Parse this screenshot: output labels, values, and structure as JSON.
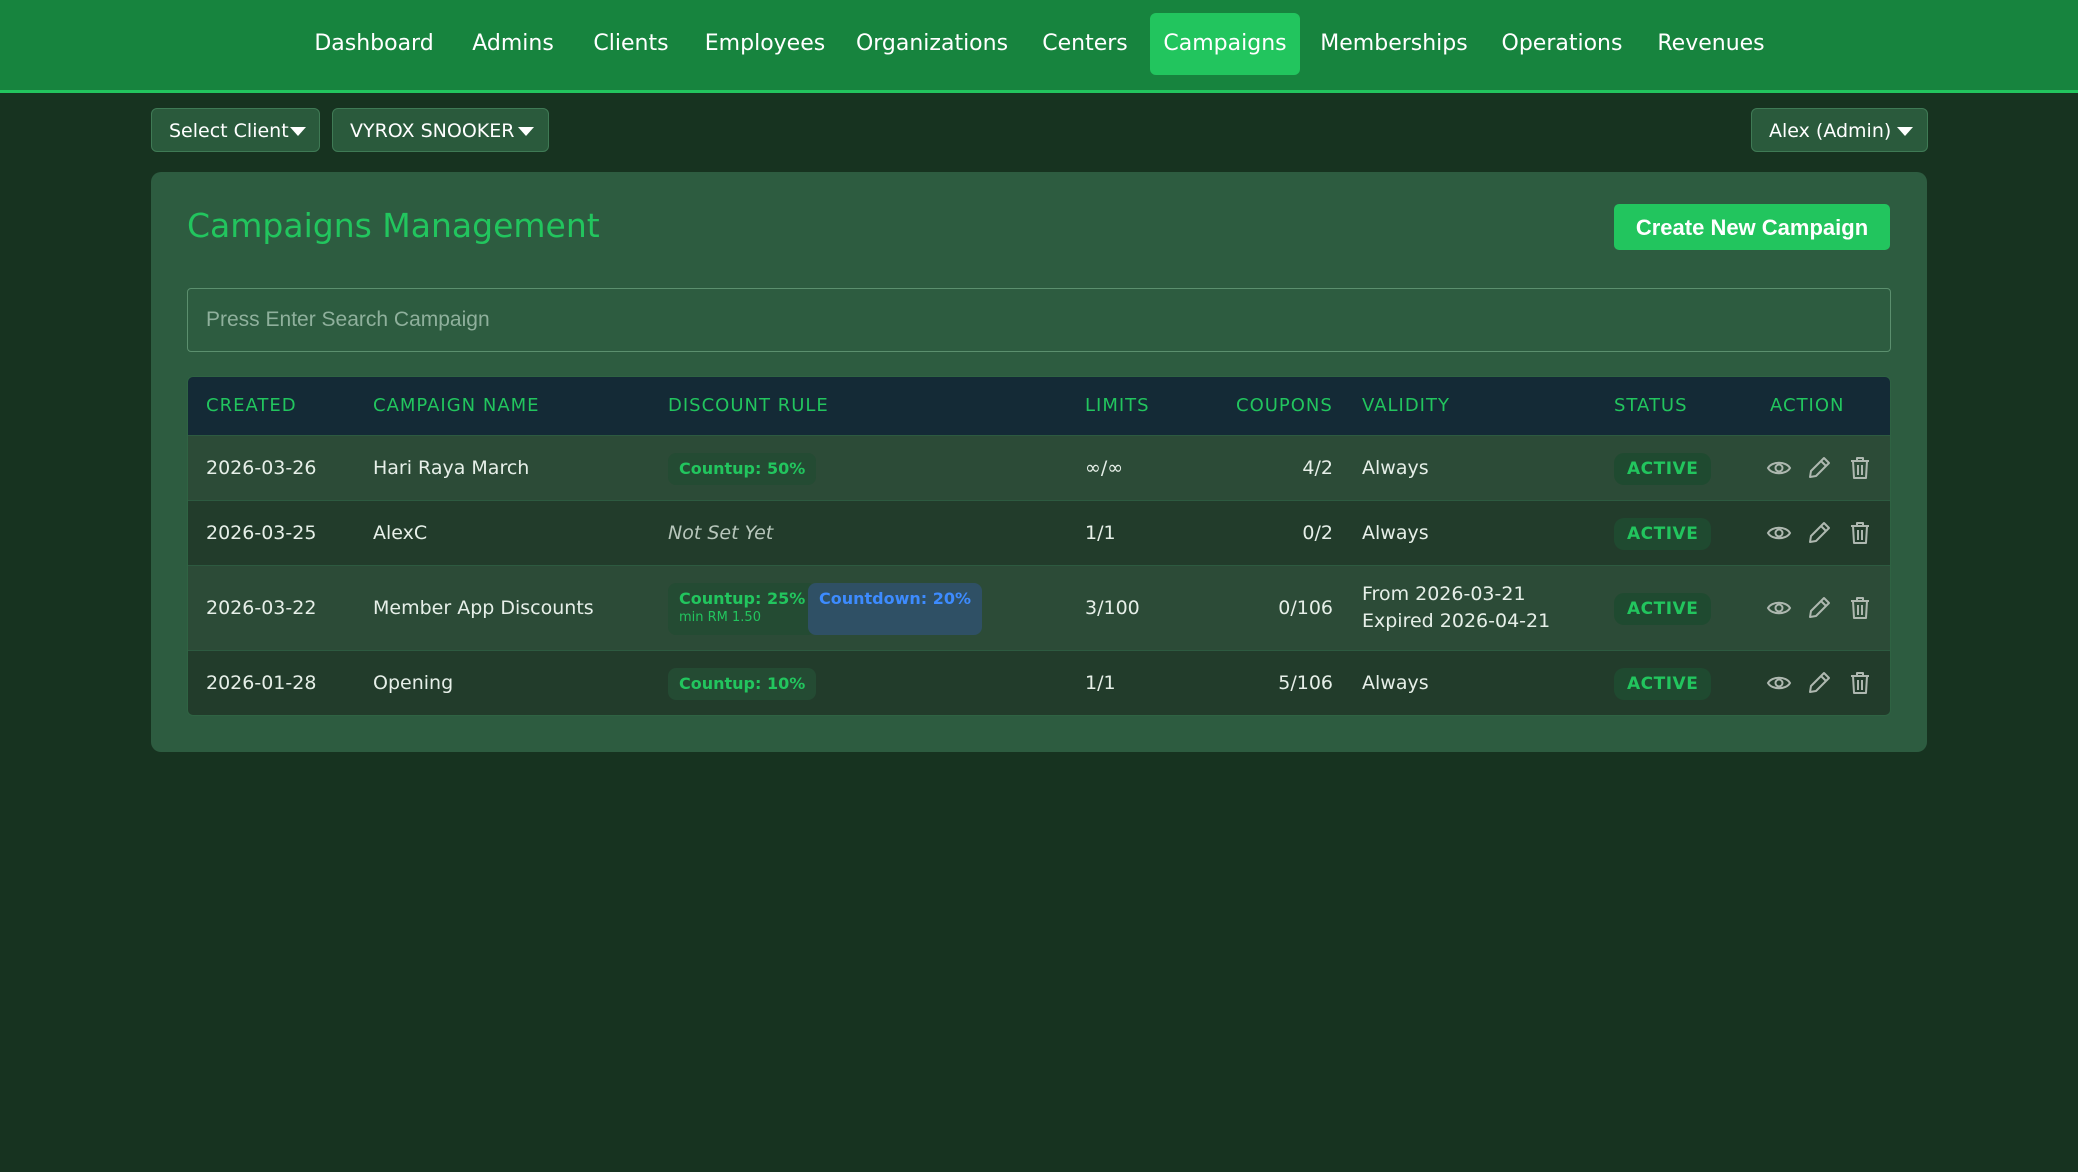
{
  "nav": {
    "items": [
      {
        "label": "Dashboard",
        "active": false
      },
      {
        "label": "Admins",
        "active": false
      },
      {
        "label": "Clients",
        "active": false
      },
      {
        "label": "Employees",
        "active": false
      },
      {
        "label": "Organizations",
        "active": false
      },
      {
        "label": "Centers",
        "active": false
      },
      {
        "label": "Campaigns",
        "active": true
      },
      {
        "label": "Memberships",
        "active": false
      },
      {
        "label": "Operations",
        "active": false
      },
      {
        "label": "Revenues",
        "active": false
      }
    ]
  },
  "selectors": {
    "client": "Select Client",
    "center": "VYROX SNOOKER",
    "user": "Alex (Admin)"
  },
  "page": {
    "title": "Campaigns Management",
    "create_button": "Create New Campaign",
    "search_placeholder": "Press Enter Search Campaign"
  },
  "table": {
    "headers": {
      "created": "CREATED",
      "name": "CAMPAIGN NAME",
      "rule": "DISCOUNT RULE",
      "limits": "LIMITS",
      "coupons": "COUPONS",
      "validity": "VALIDITY",
      "status": "STATUS",
      "action": "ACTION"
    },
    "rows": [
      {
        "created": "2026-03-26",
        "name": "Hari Raya March",
        "rule_none": "",
        "rule_a": "Countup: 50%",
        "rule_a_sub": "",
        "rule_b": "",
        "limits": "∞/∞",
        "coupons": "4/2",
        "validity_1": "Always",
        "validity_2": "",
        "status": "ACTIVE"
      },
      {
        "created": "2026-03-25",
        "name": "AlexC",
        "rule_none": "Not Set Yet",
        "rule_a": "",
        "rule_a_sub": "",
        "rule_b": "",
        "limits": "1/1",
        "coupons": "0/2",
        "validity_1": "Always",
        "validity_2": "",
        "status": "ACTIVE"
      },
      {
        "created": "2026-03-22",
        "name": "Member App Discounts",
        "rule_none": "",
        "rule_a": "Countup: 25%",
        "rule_a_sub": "min RM 1.50",
        "rule_b": "Countdown: 20%",
        "limits": "3/100",
        "coupons": "0/106",
        "validity_1": "From 2026-03-21",
        "validity_2": "Expired 2026-04-21",
        "status": "ACTIVE"
      },
      {
        "created": "2026-01-28",
        "name": "Opening",
        "rule_none": "",
        "rule_a": "Countup: 10%",
        "rule_a_sub": "",
        "rule_b": "",
        "limits": "1/1",
        "coupons": "5/106",
        "validity_1": "Always",
        "validity_2": "",
        "status": "ACTIVE"
      }
    ]
  },
  "icons": {
    "view": "eye-icon",
    "edit": "pencil-icon",
    "delete": "trash-icon",
    "dropdown": "caret-down-icon"
  },
  "colors": {
    "brand": "#22c55e",
    "nav_bg": "#17843e",
    "page_bg": "#173320",
    "panel_bg": "#2d5c40",
    "countdown": "#3d8bff"
  }
}
